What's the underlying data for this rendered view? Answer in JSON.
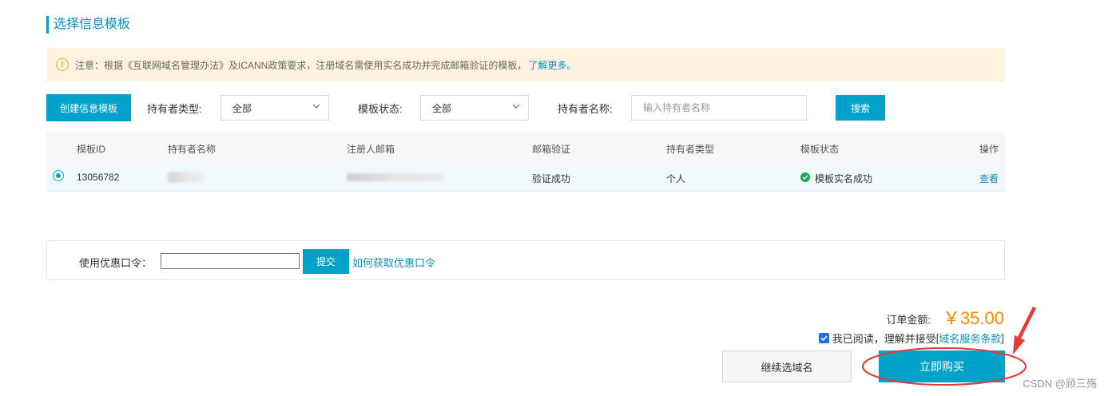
{
  "section_title": "选择信息模板",
  "notice": {
    "text": "注意：根据《互联网域名管理办法》及ICANN政策要求，注册域名需使用实名成功并完成邮箱验证的模板，",
    "link": "了解更多。",
    "icon": "info-icon"
  },
  "filters": {
    "create_button": "创建信息模板",
    "holder_type_label": "持有者类型:",
    "holder_type_value": "全部",
    "template_status_label": "模板状态:",
    "template_status_value": "全部",
    "holder_name_label": "持有者名称:",
    "holder_name_placeholder": "输入持有者名称",
    "search_button": "搜索"
  },
  "table": {
    "columns": [
      "模板ID",
      "持有者名称",
      "注册人邮箱",
      "邮箱验证",
      "持有者类型",
      "模板状态",
      "操作"
    ],
    "rows": [
      {
        "selected": true,
        "template_id": "13056782",
        "holder_name": "",
        "email": "",
        "email_verification": "验证成功",
        "holder_type": "个人",
        "template_status": "模板实名成功",
        "action": "查看"
      }
    ]
  },
  "coupon": {
    "label": "使用优惠口令：",
    "value": "",
    "submit_button": "提交",
    "help_link": "如何获取优惠口令"
  },
  "order": {
    "total_label": "订单金额:",
    "total_value": "￥35.00",
    "agree_checked": true,
    "agree_text": "我已阅读，理解并接受",
    "terms_open": "[",
    "terms_link": "域名服务条款",
    "terms_close": "]"
  },
  "actions": {
    "continue_button": "继续选域名",
    "buy_button": "立即购买"
  },
  "watermark": "CSDN @顾三殇",
  "colors": {
    "accent": "#00a2ca",
    "link": "#0b8fbf",
    "price": "#ff8a00",
    "notice_bg": "#fff3e0",
    "annotation": "#e53935",
    "success": "#1aaa55"
  }
}
